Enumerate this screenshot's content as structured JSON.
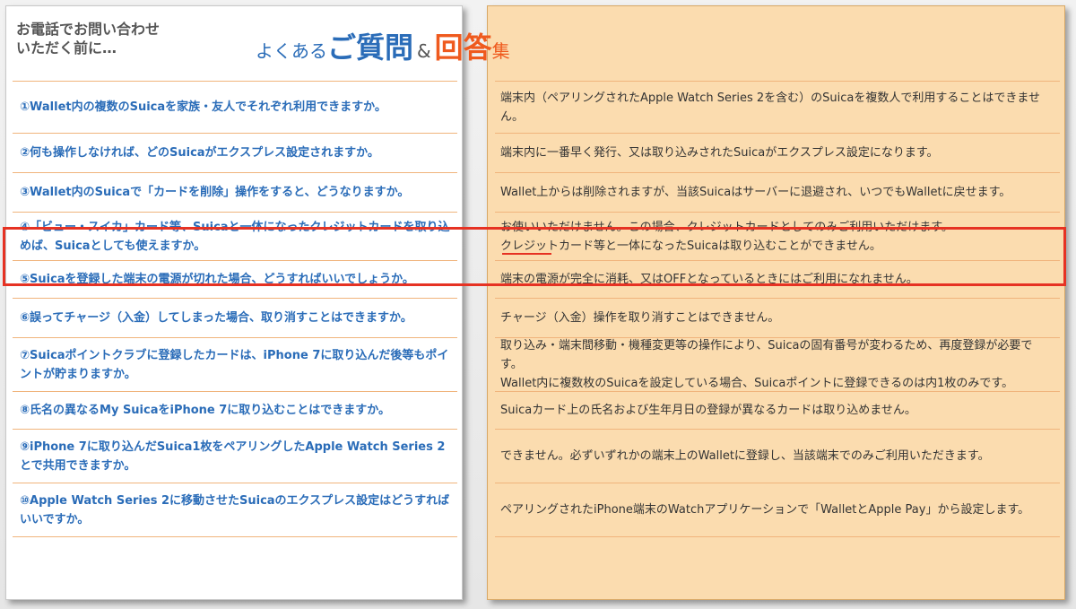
{
  "header": {
    "intro_line1": "お電話でお問い合わせ",
    "intro_line2": "いただく前に…",
    "title_pre": "よくある",
    "title_big1": "ご質問",
    "title_amp": "&",
    "title_big2": "回答",
    "title_post": "集"
  },
  "colors": {
    "question_blue": "#2a6cb8",
    "answer_panel": "#fbdcaf",
    "divider_orange": "#f0b47c",
    "highlight_red": "#e63223"
  },
  "faq": [
    {
      "q": "①Wallet内の複数のSuicaを家族・友人でそれぞれ利用できますか。",
      "a": "端末内（ペアリングされたApple Watch Series 2を含む）のSuicaを複数人で利用することはできません。"
    },
    {
      "q": "②何も操作しなければ、どのSuicaがエクスプレス設定されますか。",
      "a": "端末内に一番早く発行、又は取り込みされたSuicaがエクスプレス設定になります。"
    },
    {
      "q": "③Wallet内のSuicaで「カードを削除」操作をすると、どうなりますか。",
      "a": "Wallet上からは削除されますが、当該Suicaはサーバーに退避され、いつでもWalletに戻せます。"
    },
    {
      "q": "④「ビュー・スイカ」カード等、Suicaと一体になったクレジットカードを取り込めば、Suicaとしても使えますか。",
      "a": "お使いいただけません。この場合、クレジットカードとしてのみご利用いただけます。\nクレジットカード等と一体になったSuicaは取り込むことができません。"
    },
    {
      "q": "⑤Suicaを登録した端末の電源が切れた場合、どうすればいいでしょうか。",
      "a": "端末の電源が完全に消耗、又はOFFとなっているときにはご利用になれません。"
    },
    {
      "q": "⑥誤ってチャージ（入金）してしまった場合、取り消すことはできますか。",
      "a": "チャージ（入金）操作を取り消すことはできません。"
    },
    {
      "q": "⑦Suicaポイントクラブに登録したカードは、iPhone 7に取り込んだ後等もポイントが貯まりますか。",
      "a": "取り込み・端末間移動・機種変更等の操作により、Suicaの固有番号が変わるため、再度登録が必要です。\nWallet内に複数枚のSuicaを設定している場合、Suicaポイントに登録できるのは内1枚のみです。"
    },
    {
      "q": "⑧氏名の異なるMy SuicaをiPhone 7に取り込むことはできますか。",
      "a": "Suicaカード上の氏名および生年月日の登録が異なるカードは取り込めません。"
    },
    {
      "q": "⑨iPhone 7に取り込んだSuica1枚をペアリングしたApple Watch Series 2とで共用できますか。",
      "a": "できません。必ずいずれかの端末上のWalletに登録し、当該端末でのみご利用いただきます。"
    },
    {
      "q": "⑩Apple Watch Series 2に移動させたSuicaのエクスプレス設定はどうすればいいですか。",
      "a": "ペアリングされたiPhone端末のWatchアプリケーションで「WalletとApple Pay」から設定します。"
    }
  ]
}
